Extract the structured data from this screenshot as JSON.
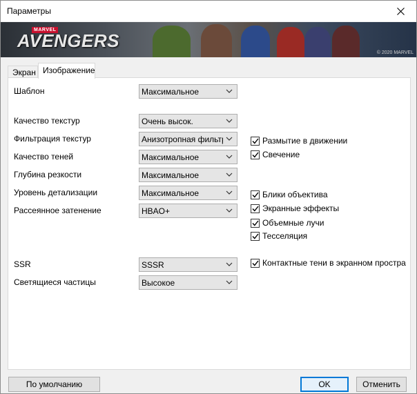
{
  "window": {
    "title": "Параметры",
    "close_symbol": "✕"
  },
  "banner": {
    "brand_small": "MARVEL",
    "brand_logo": "AVENGERS",
    "copyright": "© 2020 MARVEL"
  },
  "tabs": [
    {
      "label": "Экран",
      "active": false
    },
    {
      "label": "Изображение",
      "active": true
    }
  ],
  "settings": {
    "preset": {
      "label": "Шаблон",
      "value": "Максимальное"
    },
    "texture_quality": {
      "label": "Качество текстур",
      "value": "Очень высок."
    },
    "texture_filtering": {
      "label": "Фильтрация текстур",
      "value": "Анизотропная фильтрац"
    },
    "shadow_quality": {
      "label": "Качество теней",
      "value": "Максимальное"
    },
    "depth_of_field": {
      "label": "Глубина резкости",
      "value": "Максимальное"
    },
    "level_of_detail": {
      "label": "Уровень детализации",
      "value": "Максимальное"
    },
    "ambient_occlusion": {
      "label": "Рассеянное затенение",
      "value": "HBAO+"
    },
    "ssr": {
      "label": "SSR",
      "value": "SSSR"
    },
    "glowing_particles": {
      "label": "Светящиеся частицы",
      "value": "Высокое"
    }
  },
  "checkboxes": {
    "motion_blur": {
      "label": "Размытие в движении",
      "checked": true
    },
    "bloom": {
      "label": "Свечение",
      "checked": true
    },
    "lens_flare": {
      "label": "Блики объектива",
      "checked": true
    },
    "screen_effects": {
      "label": "Экранные эффекты",
      "checked": true
    },
    "volumetric_rays": {
      "label": "Объемные лучи",
      "checked": true
    },
    "tessellation": {
      "label": "Тесселяция",
      "checked": true
    },
    "contact_shadows": {
      "label": "Контактные тени в экранном простра",
      "checked": true
    }
  },
  "buttons": {
    "defaults": "По умолчанию",
    "ok": "OK",
    "cancel": "Отменить"
  },
  "colors": {
    "accent": "#0078d7",
    "marvel_red": "#c8102e"
  }
}
